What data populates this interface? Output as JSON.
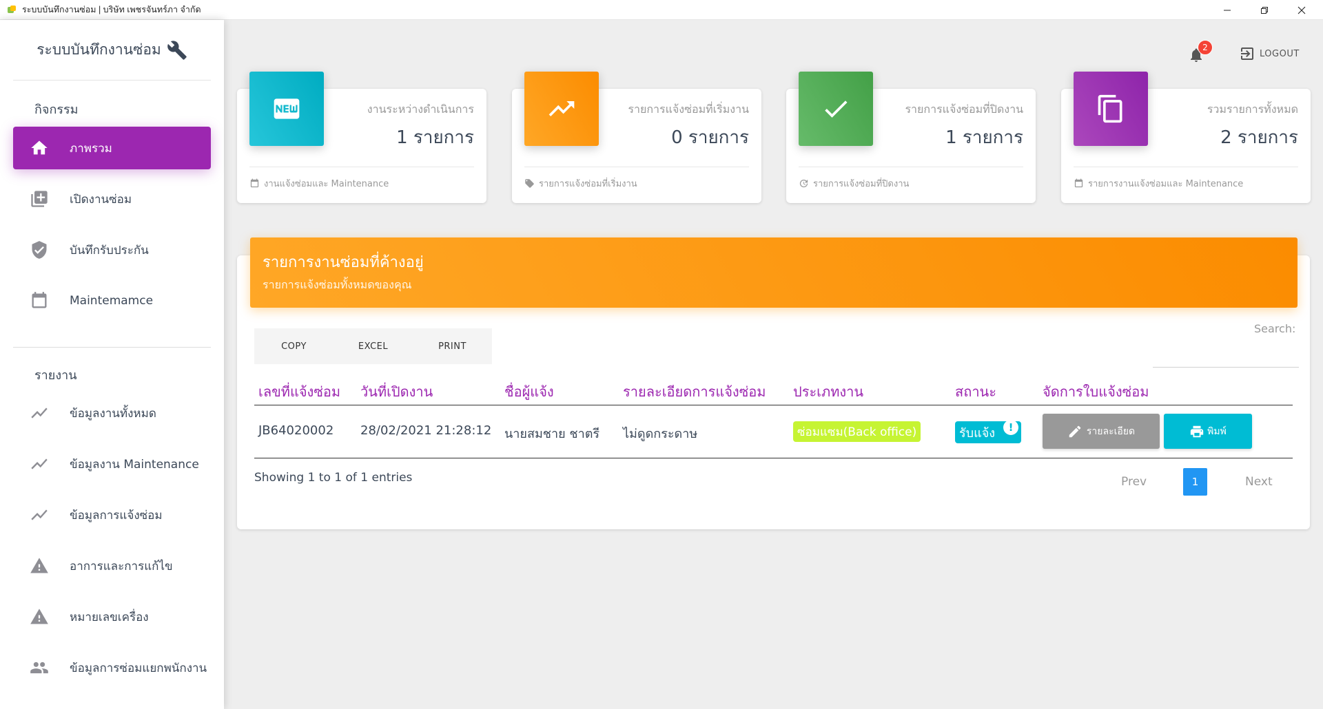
{
  "window": {
    "title": "ระบบบันทึกงานซ่อม | บริษัท เพชรจันทร์ภา จำกัด"
  },
  "sidebar": {
    "brand": "ระบบบันทึกงานซ่อม",
    "section_activity": "กิจกรรม",
    "section_report": "รายงาน",
    "items": [
      {
        "label": "ภาพรวม",
        "icon": "home-icon",
        "active": true
      },
      {
        "label": "เปิดงานซ่อม",
        "icon": "add-box-icon"
      },
      {
        "label": "บันทึกรับประกัน",
        "icon": "shield-icon"
      },
      {
        "label": "Maintemamce",
        "icon": "calendar-icon"
      }
    ],
    "report_items": [
      {
        "label": "ข้อมูลงานทั้งหมด",
        "icon": "trend-icon"
      },
      {
        "label": "ข้อมูลงาน Maintenance",
        "icon": "trend-icon"
      },
      {
        "label": "ข้อมูลการแจ้งซ่อม",
        "icon": "trend-icon"
      },
      {
        "label": "อาการและการแก้ไข",
        "icon": "warning-icon"
      },
      {
        "label": "หมายเลขเครื่อง",
        "icon": "warning-icon"
      },
      {
        "label": "ข้อมูลการซ่อมแยกพนักงาน",
        "icon": "people-icon"
      }
    ]
  },
  "topbar": {
    "notification_count": "2",
    "logout_label": "LOGOUT"
  },
  "cards": [
    {
      "category": "งานระหว่างดำเนินการ",
      "value": "1 รายการ",
      "footer": "งานแจ้งซ่อมและ Maintenance",
      "color": "#26c6da",
      "icon": "new-icon"
    },
    {
      "category": "รายการแจ้งซ่อมที่เริ่มงาน",
      "value": "0 รายการ",
      "footer": "รายการแจ้งซ่อมที่เริ่มงาน",
      "color": "#ffa726",
      "icon": "trending-up-icon"
    },
    {
      "category": "รายการแจ้งซ่อมที่ปิดงาน",
      "value": "1 รายการ",
      "footer": "รายการแจ้งซ่อมที่ปิดงาน",
      "color": "#66bb6a",
      "icon": "check-icon"
    },
    {
      "category": "รวมรายการทั้งหมด",
      "value": "2 รายการ",
      "footer": "รายการงานแจ้งซ่อมและ Maintenance",
      "color": "#ab47bc",
      "icon": "copy-icon"
    }
  ],
  "panel": {
    "title": "รายการงานซ่อมที่ค้างอยู่",
    "subtitle": "รายการแจ้งซ่อมทั้งหมดของคุณ",
    "buttons": [
      "COPY",
      "EXCEL",
      "PRINT"
    ],
    "search_label": "Search:",
    "columns": [
      "เลขที่แจ้งซ่อม",
      "วันที่เปิดงาน",
      "ชื่อผู้แจ้ง",
      "รายละเอียดการแจ้งซ่อม",
      "ประเภทงาน",
      "สถานะ",
      "จัดการใบแจ้งซ่อม"
    ],
    "rows": [
      {
        "job_no": "JB64020002",
        "date": "28/02/2021 21:28:12",
        "reporter": "นายสมชาย ชาตรี",
        "detail": "ไม่ดูดกระดาษ",
        "type": "ซ่อมแซม(Back office)",
        "status": "รับแจ้ง",
        "status_mark": "!",
        "detail_button": "รายละเอียด",
        "print_button": "พิมพ์"
      }
    ],
    "info": "Showing 1 to 1 of 1 entries",
    "pagination": {
      "prev": "Prev",
      "current": "1",
      "next": "Next"
    }
  }
}
